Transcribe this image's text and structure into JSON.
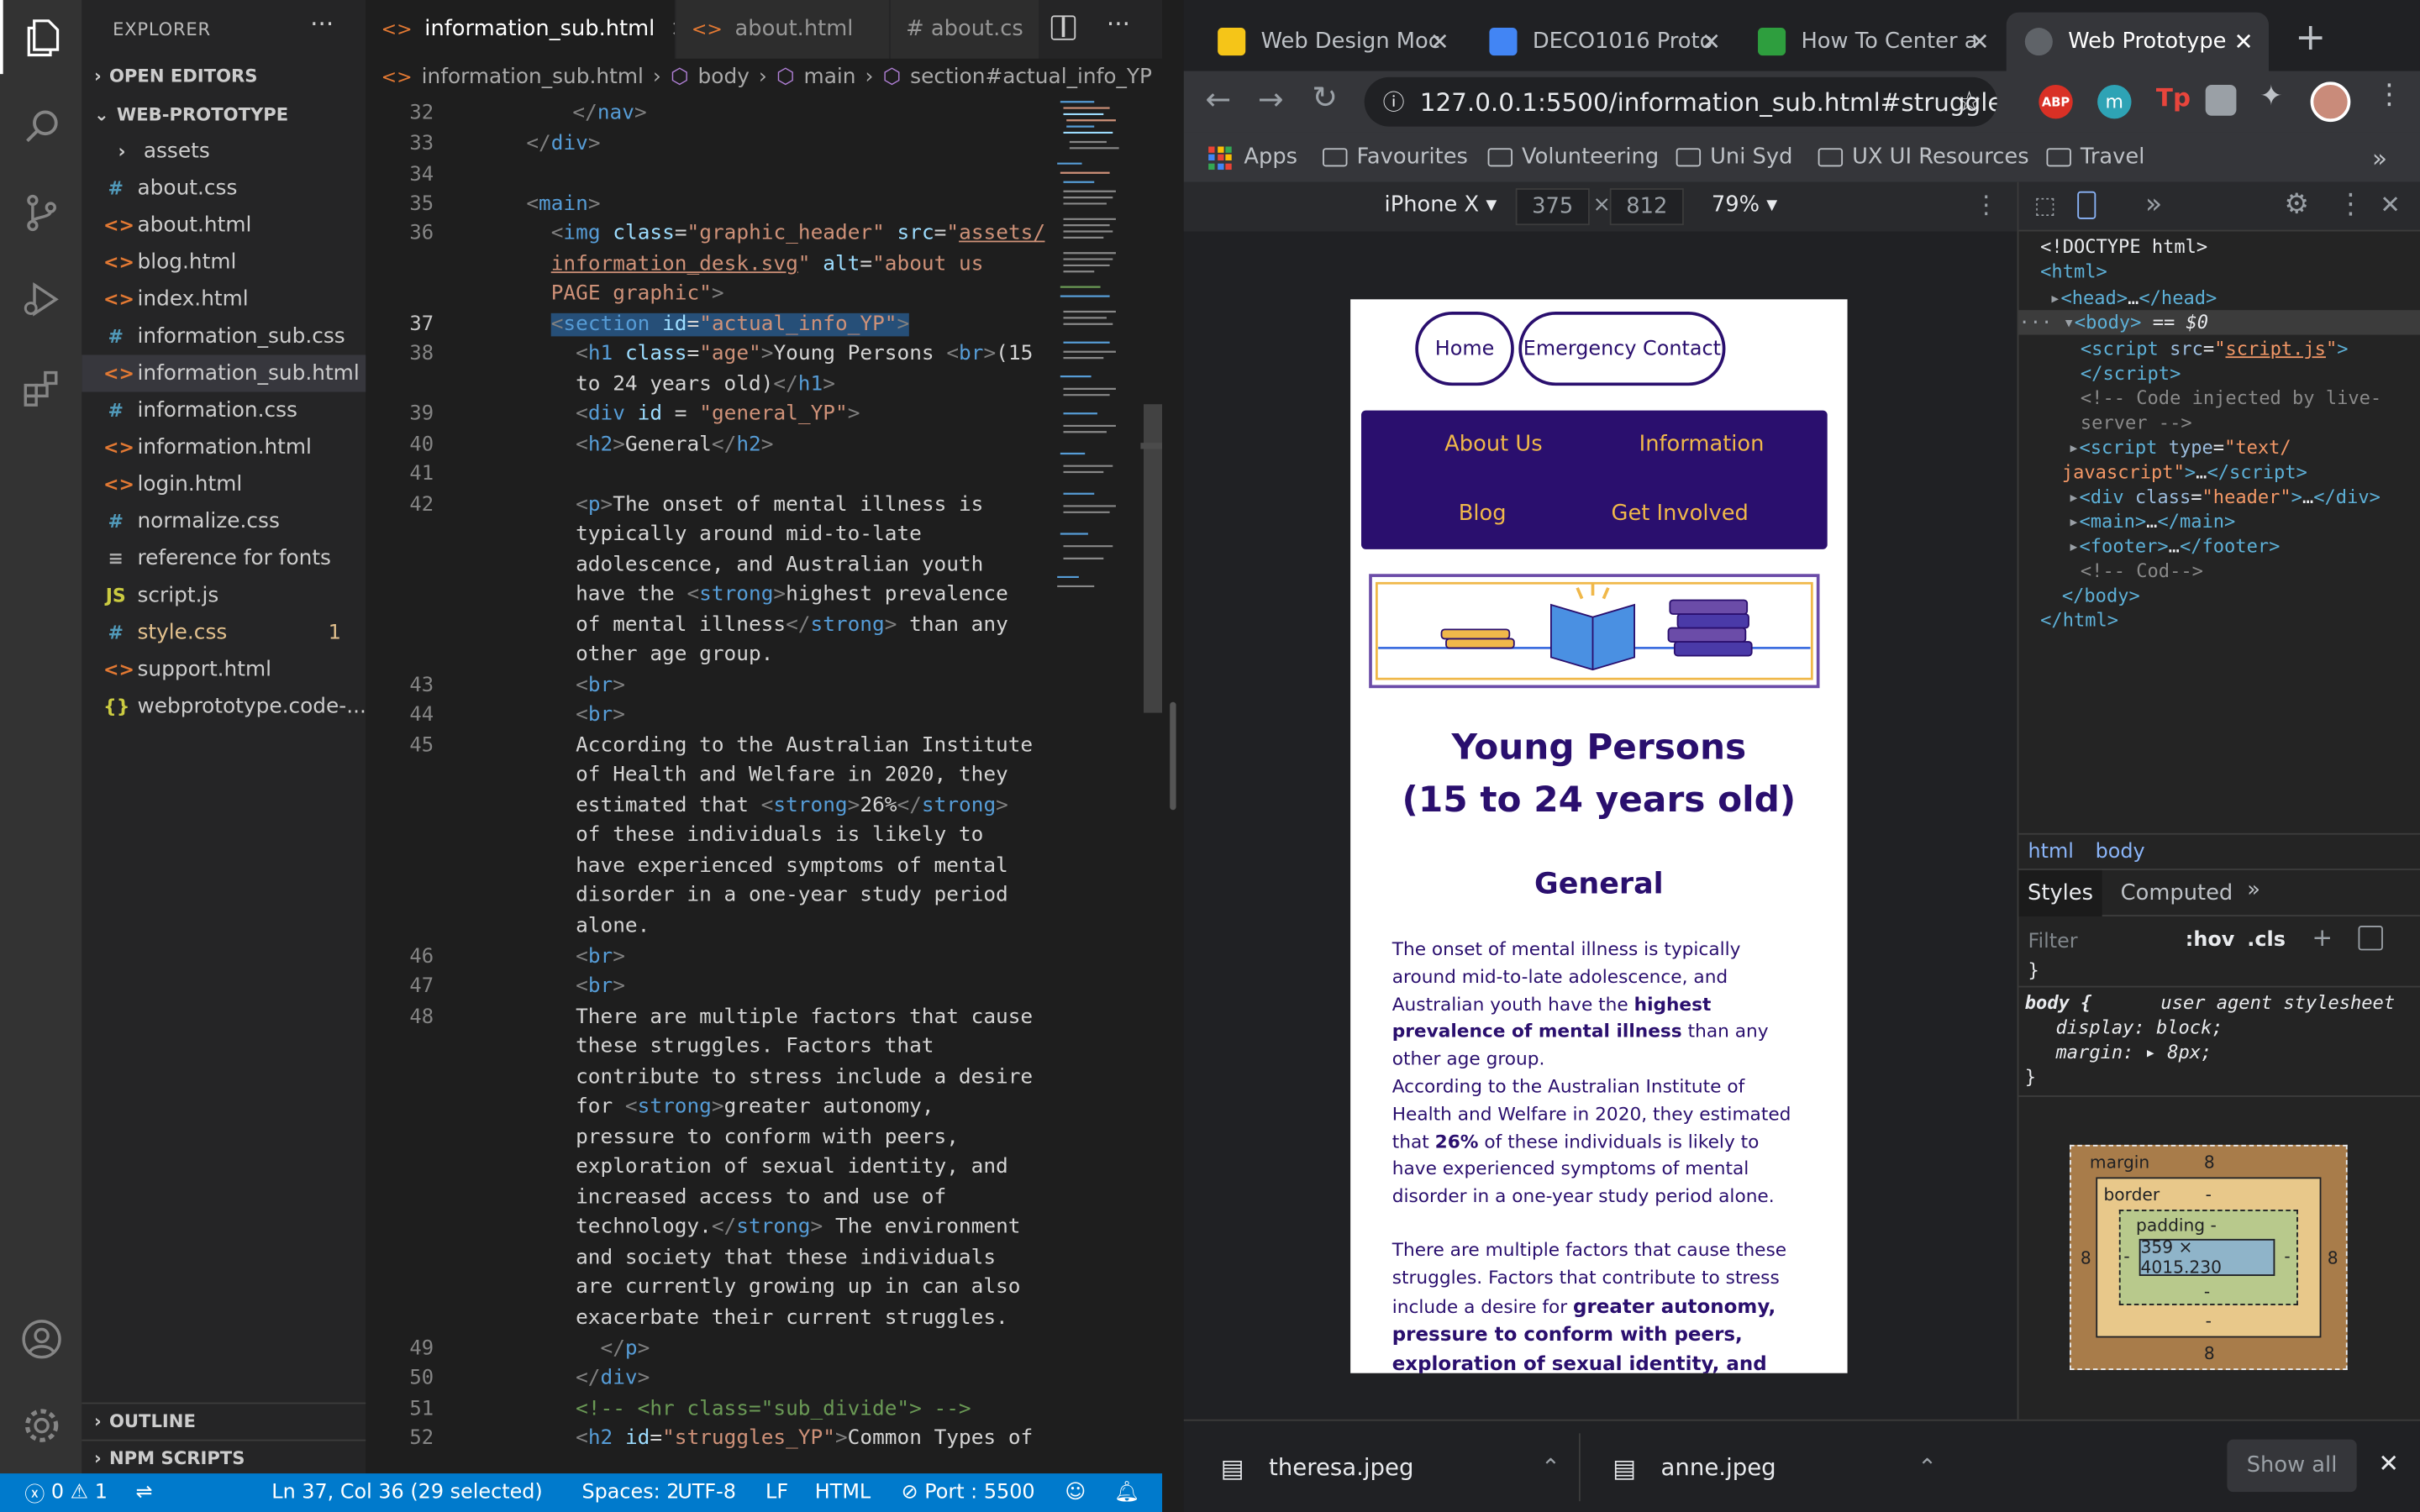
{
  "vscode": {
    "explorer_title": "EXPLORER",
    "more": "···",
    "open_editors": "OPEN EDITORS",
    "project": "WEB-PROTOTYPE",
    "files": [
      {
        "icon": "›",
        "name": "assets",
        "kind": "folder"
      },
      {
        "icon": "#",
        "name": "about.css",
        "kind": "css"
      },
      {
        "icon": "<>",
        "name": "about.html",
        "kind": "html"
      },
      {
        "icon": "<>",
        "name": "blog.html",
        "kind": "html"
      },
      {
        "icon": "<>",
        "name": "index.html",
        "kind": "html"
      },
      {
        "icon": "#",
        "name": "information_sub.css",
        "kind": "css"
      },
      {
        "icon": "<>",
        "name": "information_sub.html",
        "kind": "html",
        "selected": true
      },
      {
        "icon": "#",
        "name": "information.css",
        "kind": "css"
      },
      {
        "icon": "<>",
        "name": "information.html",
        "kind": "html"
      },
      {
        "icon": "<>",
        "name": "login.html",
        "kind": "html"
      },
      {
        "icon": "#",
        "name": "normalize.css",
        "kind": "css"
      },
      {
        "icon": "≡",
        "name": "reference for fonts",
        "kind": "text"
      },
      {
        "icon": "JS",
        "name": "script.js",
        "kind": "js"
      },
      {
        "icon": "#",
        "name": "style.css",
        "kind": "css",
        "badge": "1",
        "modified": true
      },
      {
        "icon": "<>",
        "name": "support.html",
        "kind": "html"
      },
      {
        "icon": "{}",
        "name": "webprototype.code-...",
        "kind": "json"
      }
    ],
    "outline": "OUTLINE",
    "npm": "NPM SCRIPTS",
    "tabs": [
      {
        "label": "information_sub.html",
        "icon": "<>",
        "active": true,
        "close": "×"
      },
      {
        "label": "about.html",
        "icon": "<>"
      },
      {
        "label": "# about.cs",
        "icon": ""
      }
    ],
    "breadcrumbs": [
      "information_sub.html",
      "body",
      "main",
      "section#actual_info_YP"
    ],
    "line_numbers": [
      32,
      33,
      34,
      35,
      36,
      37,
      38,
      39,
      40,
      41,
      42,
      43,
      44,
      45,
      46,
      47,
      48,
      49,
      50,
      51,
      52
    ],
    "status": {
      "errors": "0",
      "warnings": "1",
      "position": "Ln 37, Col 36 (29 selected)",
      "spaces": "Spaces: 2",
      "encoding": "UTF-8",
      "eol": "LF",
      "language": "HTML",
      "port": "Port : 5500"
    }
  },
  "chrome": {
    "tabs": [
      {
        "title": "Web Design Moc",
        "fav_color": "#f5c518"
      },
      {
        "title": "DECO1016 Proto",
        "fav_color": "#4285f4"
      },
      {
        "title": "How To Center a",
        "fav_color": "#2e9e3e"
      },
      {
        "title": "Web Prototype",
        "fav_color": "#5f6368",
        "active": true
      }
    ],
    "new_tab": "+",
    "url": "127.0.0.1:5500/information_sub.html#struggle...",
    "bookmarks": [
      "Apps",
      "Favourites",
      "Volunteering",
      "Uni Syd",
      "UX UI Resources",
      "Travel"
    ],
    "bookmarks_more": "»",
    "device": {
      "name": "iPhone X",
      "width": "375",
      "height": "812",
      "zoom": "79%"
    },
    "page": {
      "nav_home": "Home",
      "nav_emergency": "Emergency Contact",
      "menu": [
        "About Us",
        "Information",
        "Blog",
        "Get Involved"
      ],
      "heading_line1": "Young Persons",
      "heading_line2": "(15 to 24 years old)",
      "subheading": "General",
      "p1_a": "The onset of mental illness is typically around mid-to-late adolescence, and Australian youth have the ",
      "p1_b": "highest prevalence of mental illness",
      "p1_c": " than any other age group.",
      "p2_a": "According to the Australian Institute of Health and Welfare in 2020, they estimated that ",
      "p2_b": "26%",
      "p2_c": " of these individuals is likely to have experienced symptoms of mental disorder in a one-year study period alone.",
      "p3_a": "There are multiple factors that cause these struggles. Factors that contribute to stress include a desire for ",
      "p3_b": "greater autonomy, pressure to conform with peers, exploration of sexual identity, and increased access to and use"
    },
    "devtools": {
      "crumb_html": "html",
      "crumb_body": "body",
      "tab_styles": "Styles",
      "tab_computed": "Computed",
      "filter_placeholder": "Filter",
      "hov": ":hov",
      "cls": ".cls",
      "rule_selector": "body {",
      "rule_source": "user agent stylesheet",
      "decl1": "display: block;",
      "decl2": "margin: ▸ 8px;",
      "box_margin": "margin",
      "box_margin_val": "8",
      "box_border": "border",
      "box_padding": "padding -",
      "box_dash": "-",
      "box_content": "359 × 4015.230"
    },
    "downloads": [
      {
        "name": "theresa.jpeg"
      },
      {
        "name": "anne.jpeg"
      }
    ],
    "show_all": "Show all"
  }
}
